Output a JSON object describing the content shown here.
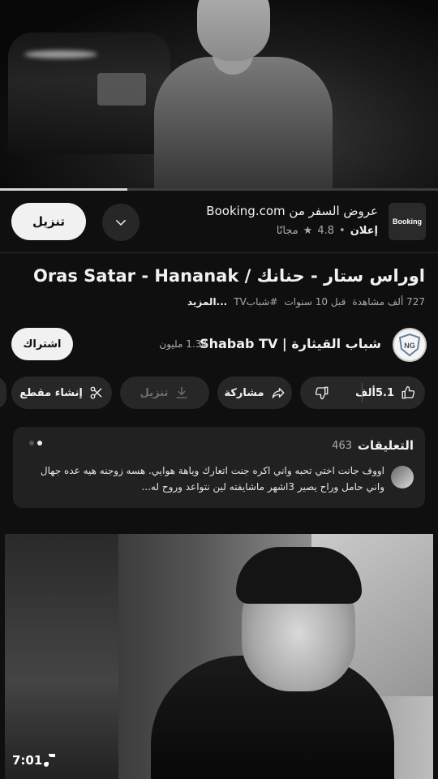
{
  "player": {
    "progress": 0.29
  },
  "ad": {
    "logo_text": "Booking",
    "title": "عروض السفر من Booking.com",
    "label": "إعلان",
    "separator": "•",
    "rating": "4.8",
    "price": "مجانًا",
    "install_label": "تنزيل"
  },
  "video": {
    "title": "اوراس ستار - حنانك / Oras Satar - Hananak",
    "views": "727 ألف مشاهدة",
    "age": "قبل 10 سنوات",
    "hashtag": "#شبابTV",
    "more": "...المزيد"
  },
  "channel": {
    "avatar_text": "NG",
    "name": "شباب القيثارة | Shabab TV",
    "subscribers": "1.34 مليون",
    "subscribe_label": "اشتراك"
  },
  "actions": {
    "likes": "5.1ألف",
    "share": "مشاركة",
    "download": "تنزيل",
    "clip": "إنشاء مقطع"
  },
  "comments": {
    "title": "التعليقات",
    "count": "463",
    "top_comment": "اووف جانت اختي تحبه واني اكره جنت اتعارك وياهة هوايي. هسه زوجنه هيه عده جهال واني حامل وراح يصير 3اشهر ماشايفته لين نتواعد وروح له..."
  },
  "status_bar": {
    "time": "7:01"
  },
  "colors": {
    "background": "#0f0f0f",
    "surface": "#272727",
    "text": "#f1f1f1",
    "muted": "#aaaaaa"
  }
}
